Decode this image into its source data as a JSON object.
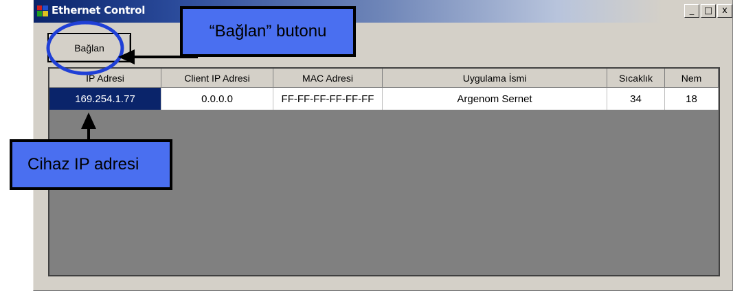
{
  "window": {
    "title": "Ethernet Control",
    "min_glyph": "_",
    "max_glyph": "□",
    "close_glyph": "x"
  },
  "toolbar": {
    "connect_label": "Bağlan"
  },
  "table": {
    "headers": [
      "IP Adresi",
      "Client IP Adresi",
      "MAC Adresi",
      "Uygulama İsmi",
      "Sıcaklık",
      "Nem"
    ],
    "rows": [
      [
        "169.254.1.77",
        "0.0.0.0",
        "FF-FF-FF-FF-FF-FF",
        "Argenom Sernet",
        "34",
        "18"
      ]
    ]
  },
  "annotations": {
    "connect_callout": "“Bağlan” butonu",
    "ip_callout": "Cihaz IP adresi"
  },
  "colors": {
    "selection": "#0a246a",
    "callout_fill": "#4a6ff0",
    "highlight_circle": "#1f3fd6",
    "grid_background": "#808080"
  }
}
